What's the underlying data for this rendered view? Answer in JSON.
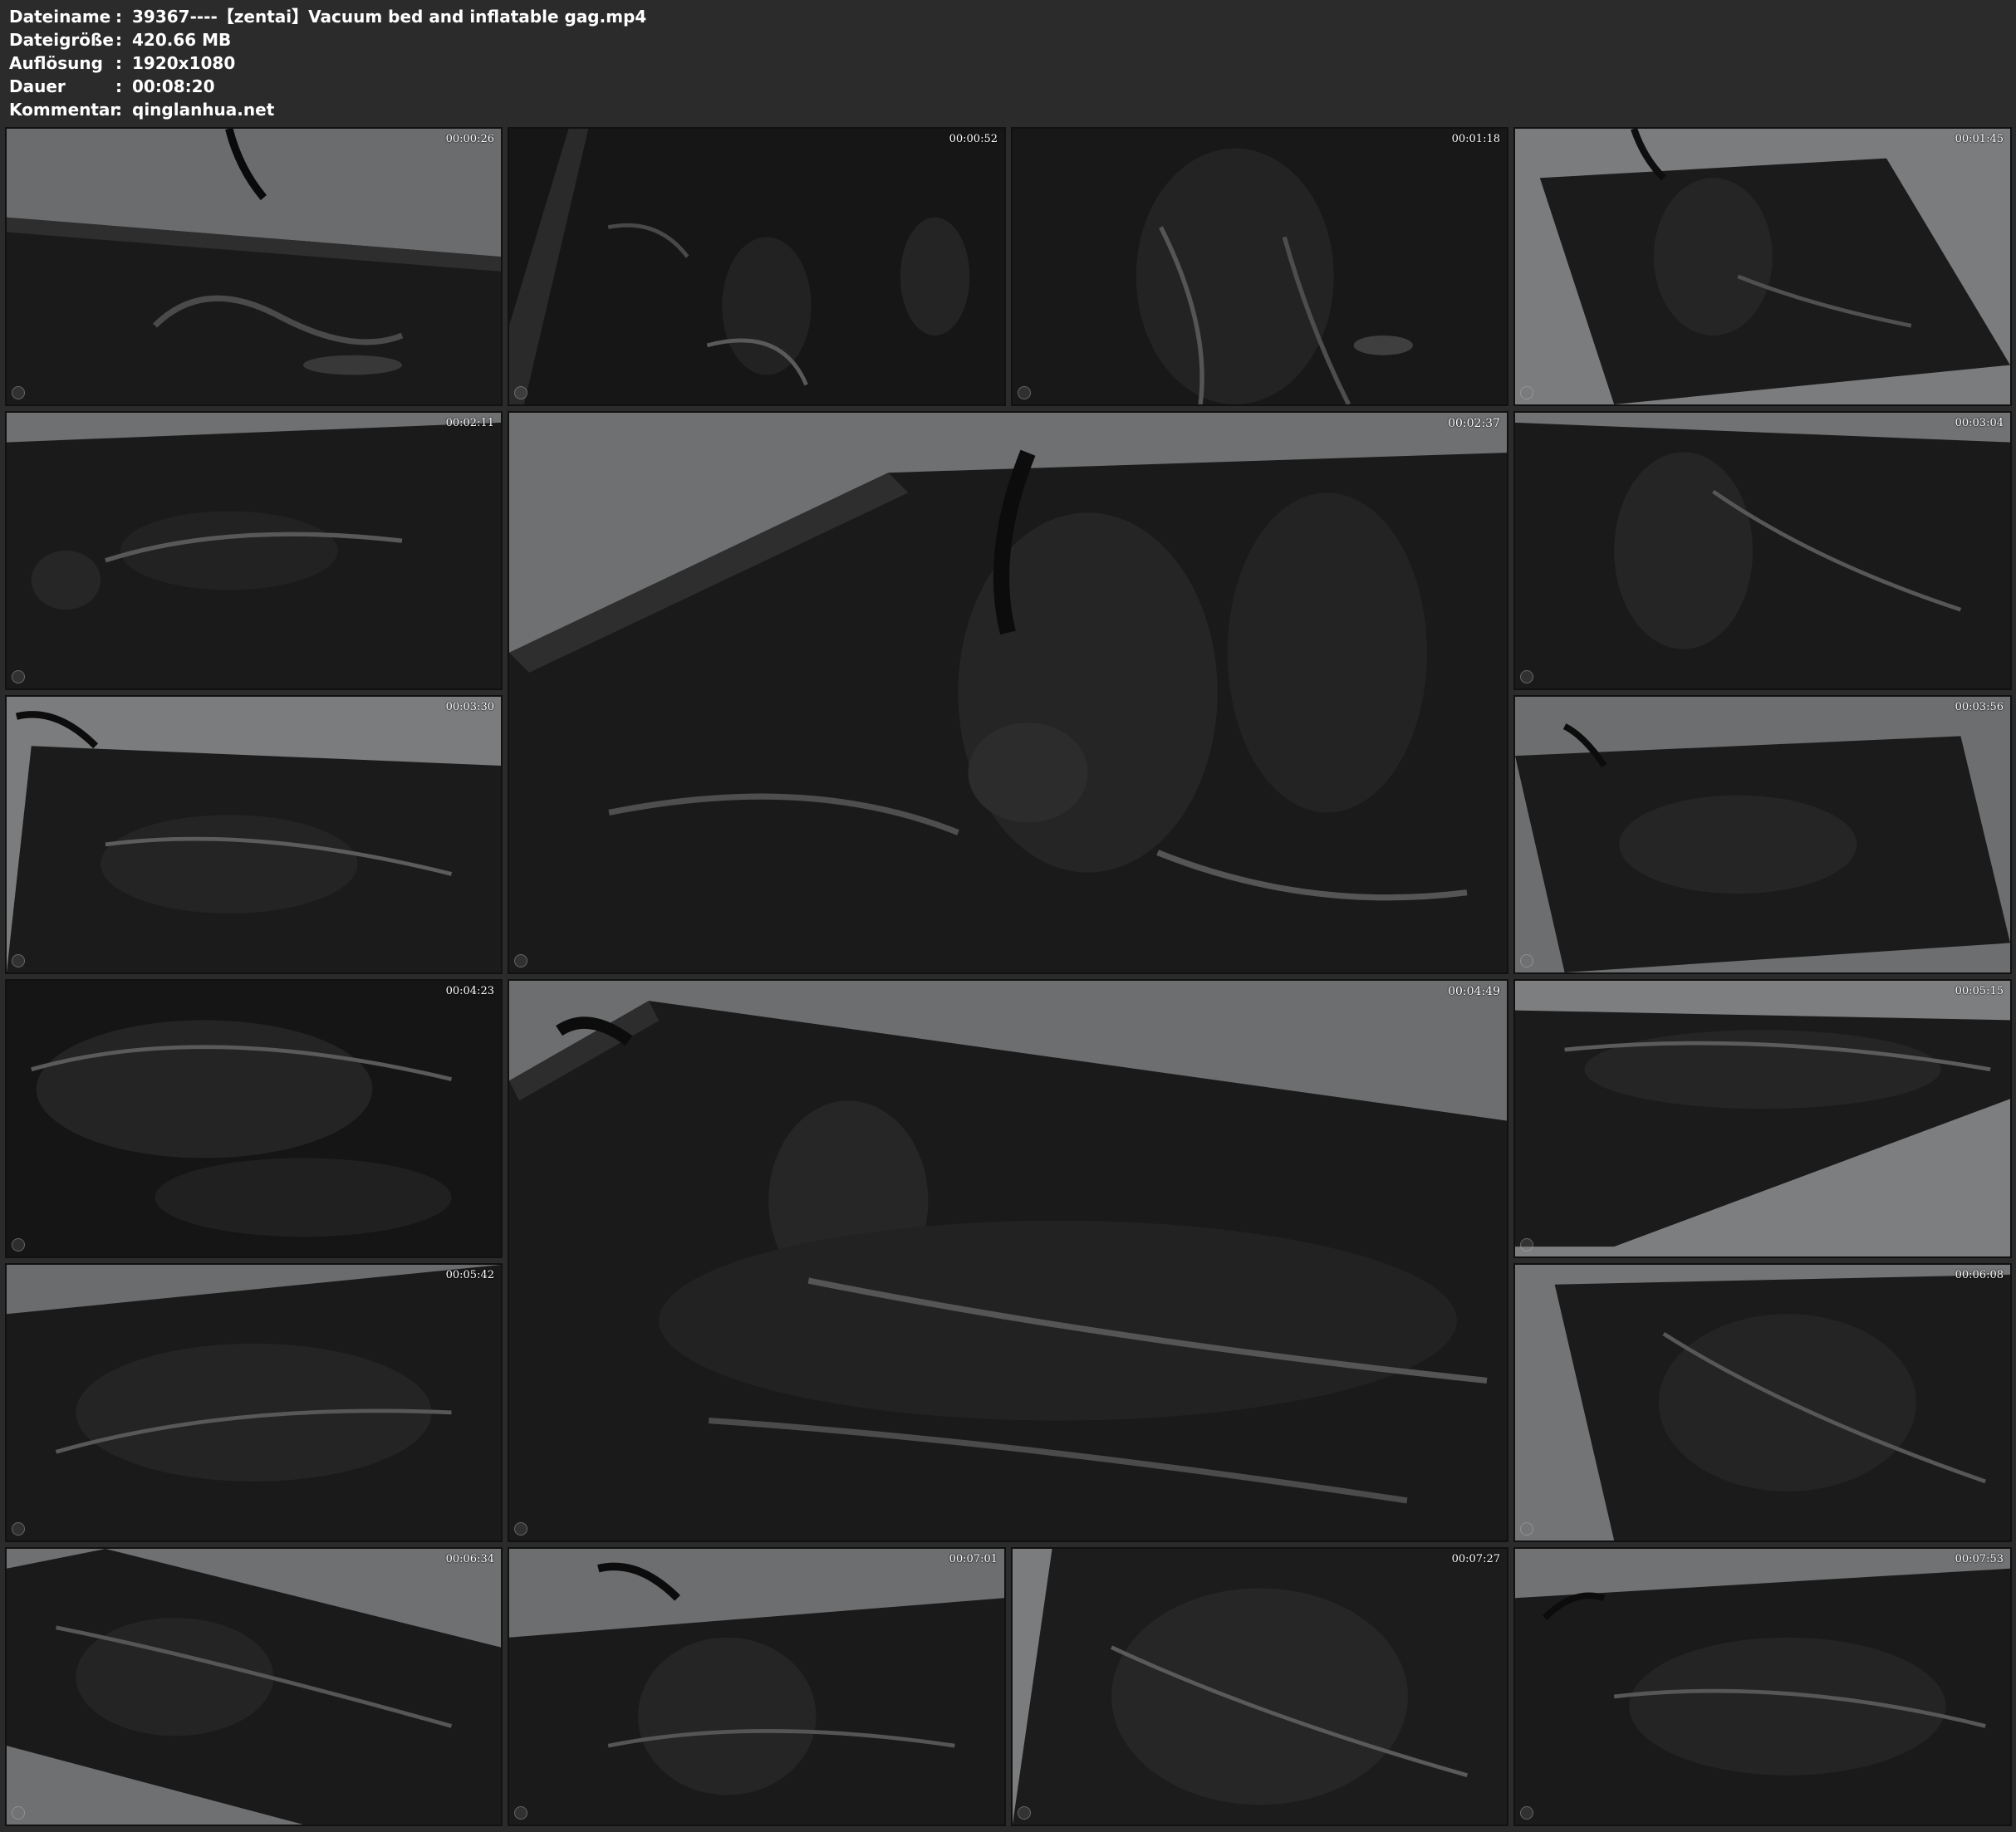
{
  "file_info": {
    "filename": {
      "label": "Dateiname",
      "sep": ":",
      "value": "39367----【zentai】Vacuum bed and inflatable gag.mp4"
    },
    "filesize": {
      "label": "Dateigröße",
      "sep": ":",
      "value": "420.66 MB"
    },
    "resolution": {
      "label": "Auflösung",
      "sep": ":",
      "value": "1920x1080"
    },
    "duration": {
      "label": "Dauer",
      "sep": ":",
      "value": "00:08:20"
    },
    "comment": {
      "label": "Kommentar",
      "sep": ":",
      "value": "qinglanhua.net"
    }
  },
  "thumbnails": [
    {
      "timestamp": "00:00:26"
    },
    {
      "timestamp": "00:00:52"
    },
    {
      "timestamp": "00:01:18"
    },
    {
      "timestamp": "00:01:45"
    },
    {
      "timestamp": "00:02:11"
    },
    {
      "timestamp": "00:02:37"
    },
    {
      "timestamp": "00:03:04"
    },
    {
      "timestamp": "00:03:30"
    },
    {
      "timestamp": "00:03:56"
    },
    {
      "timestamp": "00:04:23"
    },
    {
      "timestamp": "00:04:49"
    },
    {
      "timestamp": "00:05:15"
    },
    {
      "timestamp": "00:05:42"
    },
    {
      "timestamp": "00:06:08"
    },
    {
      "timestamp": "00:06:34"
    },
    {
      "timestamp": "00:07:01"
    },
    {
      "timestamp": "00:07:27"
    },
    {
      "timestamp": "00:07:53"
    }
  ],
  "colors": {
    "background": "#2b2b2b",
    "text": "#ffffff",
    "sheet_gray": "#6e7072",
    "latex_black": "#141414"
  }
}
